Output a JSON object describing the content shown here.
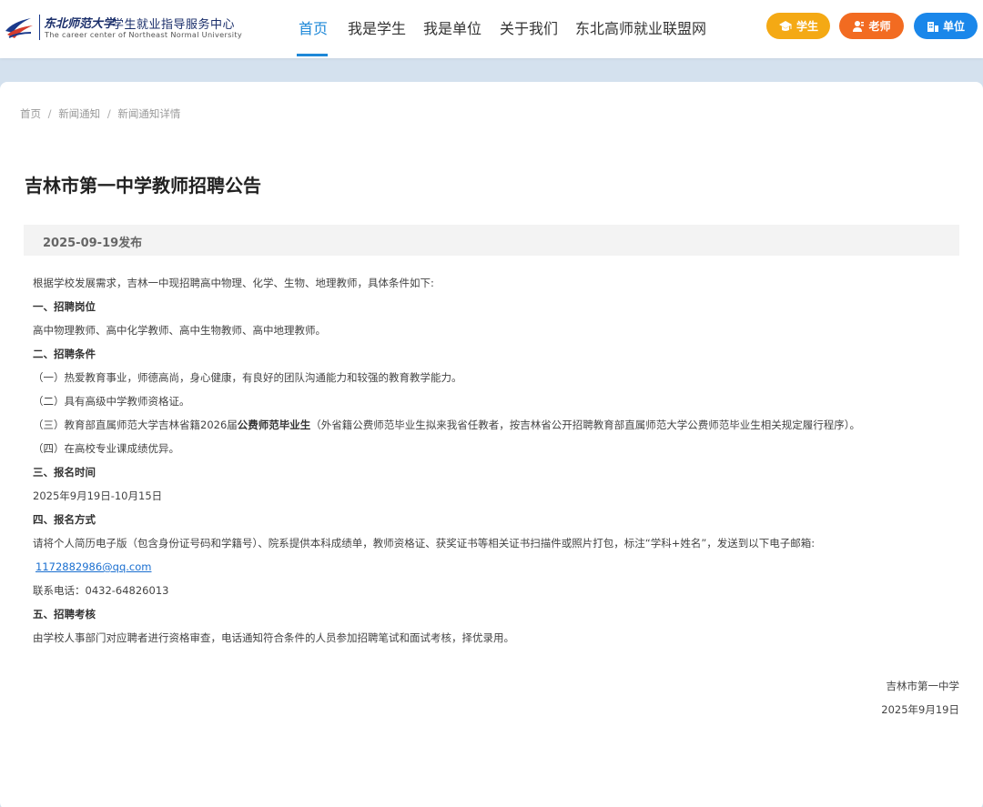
{
  "header": {
    "logo_script": "东北师范大学",
    "logo_name": "学生就业指导服务中心",
    "logo_english": "The career center of Northeast Normal University",
    "nav": [
      "首页",
      "我是学生",
      "我是单位",
      "关于我们",
      "东北高师就业联盟网"
    ],
    "active_nav": "首页",
    "role_buttons": {
      "student": "学生",
      "teacher": "老师",
      "unit": "单位"
    },
    "colors": {
      "accent": "#1e88d8",
      "student": "#f4a914",
      "teacher": "#f26b21",
      "unit": "#1a87ea"
    },
    "icons": [
      "graduation-cap-icon",
      "teacher-icon",
      "building-icon"
    ]
  },
  "breadcrumb": [
    "首页",
    "新闻通知",
    "新闻通知详情"
  ],
  "article": {
    "title": "吉林市第一中学教师招聘公告",
    "published": "2025-09-19发布",
    "intro": "根据学校发展需求，吉林一中现招聘高中物理、化学、生物、地理教师，具体条件如下:",
    "s1_heading": "一、招聘岗位",
    "s1_text": "高中物理教师、高中化学教师、高中生物教师、高中地理教师。",
    "s2_heading": "二、招聘条件",
    "s2_item1": "（一）热爱教育事业，师德高尚，身心健康，有良好的团队沟通能力和较强的教育教学能力。",
    "s2_item2": "（二）具有高级中学教师资格证。",
    "s2_item3_pre": "（三）教育部直属师范大学吉林省籍2026届",
    "s2_item3_bold": "公费师范毕业生",
    "s2_item3_post": "（外省籍公费师范毕业生拟来我省任教者，按吉林省公开招聘教育部直属师范大学公费师范毕业生相关规定履行程序）。",
    "s2_item4": "（四）在高校专业课成绩优异。",
    "s3_heading": "三、报名时间",
    "s3_text": "2025年9月19日-10月15日",
    "s4_heading": "四、报名方式",
    "s4_text": "请将个人简历电子版（包含身份证号码和学籍号）、院系提供本科成绩单，教师资格证、获奖证书等相关证书扫描件或照片打包，标注“学科+姓名”，发送到以下电子邮箱:",
    "s4_email": "1172882986@qq.com",
    "s4_phone": "联系电话：0432-64826013",
    "s5_heading": "五、招聘考核",
    "s5_text": "由学校人事部门对应聘者进行资格审查，电话通知符合条件的人员参加招聘笔试和面试考核，择优录用。",
    "signature_org": "吉林市第一中学",
    "signature_date": "2025年9月19日"
  }
}
